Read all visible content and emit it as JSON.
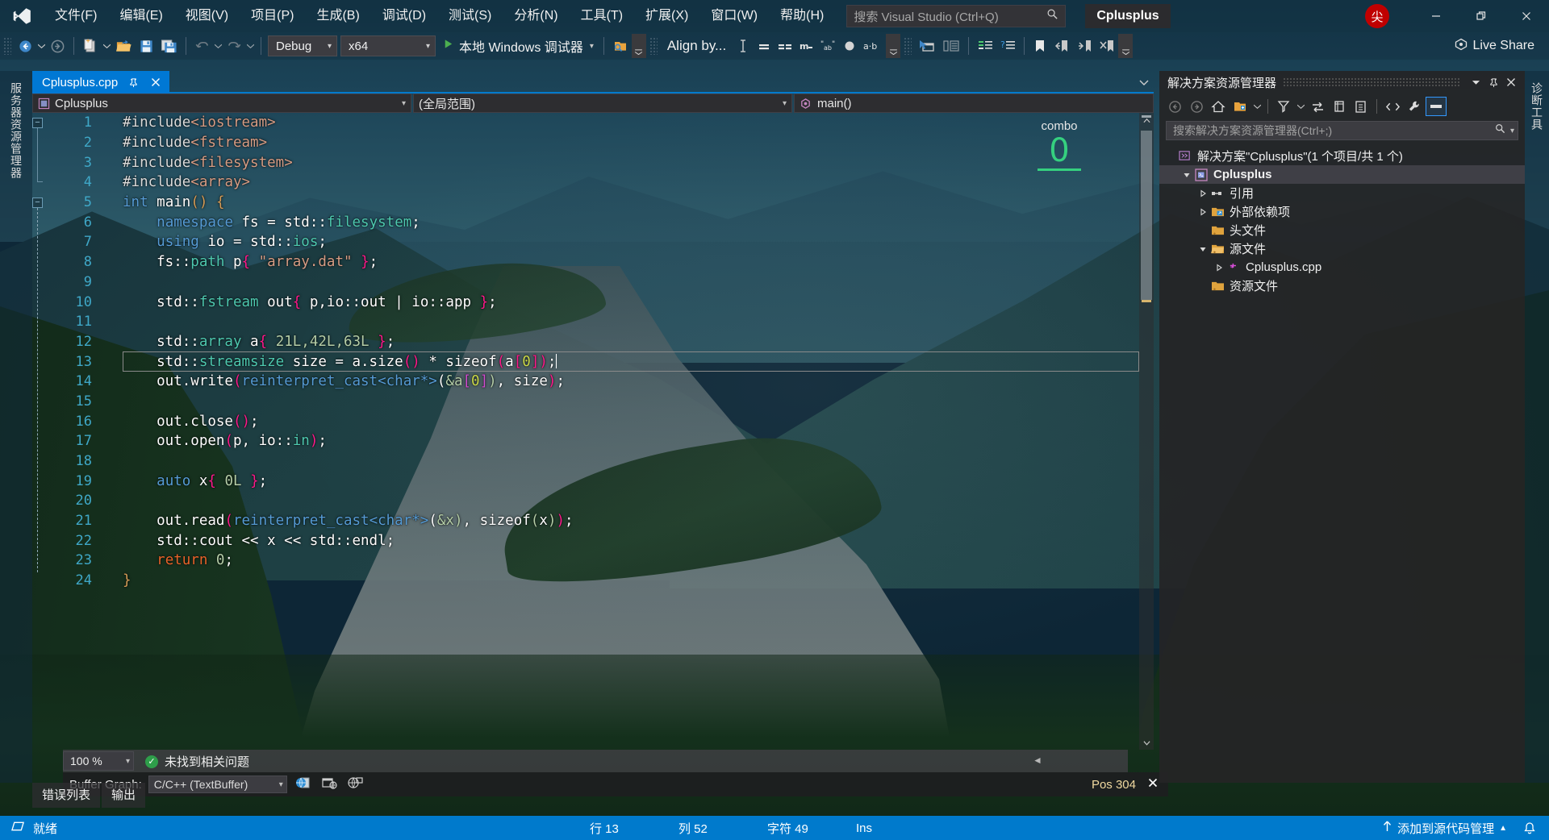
{
  "titlebar": {
    "logo_icon": "visual-studio-logo",
    "menus": [
      {
        "label": "文件(F)"
      },
      {
        "label": "编辑(E)"
      },
      {
        "label": "视图(V)"
      },
      {
        "label": "项目(P)"
      },
      {
        "label": "生成(B)"
      },
      {
        "label": "调试(D)"
      },
      {
        "label": "测试(S)"
      },
      {
        "label": "分析(N)"
      },
      {
        "label": "工具(T)"
      },
      {
        "label": "扩展(X)"
      },
      {
        "label": "窗口(W)"
      },
      {
        "label": "帮助(H)"
      }
    ],
    "search_placeholder": "搜索 Visual Studio (Ctrl+Q)",
    "search_icon": "search-icon",
    "project_chip": "Cplusplus",
    "avatar_text": "尖",
    "avatar_color": "#c00000",
    "minimize_icon": "minimize-icon",
    "restore_icon": "restore-icon",
    "close_icon": "close-icon"
  },
  "toolbar": {
    "nav_back_icon": "navigate-back-icon",
    "nav_forward_icon": "navigate-forward-icon",
    "new_item_icon": "new-item-icon",
    "open_file_icon": "open-file-icon",
    "save_icon": "save-icon",
    "save_all_icon": "save-all-icon",
    "undo_icon": "undo-icon",
    "redo_icon": "redo-icon",
    "config_value": "Debug",
    "platform_value": "x64",
    "run_label": "本地 Windows 调试器",
    "run_icon": "play-icon",
    "find_icon": "find-in-files-icon",
    "align_label": "Align by...",
    "align_icons": [
      "text-cursor-icon",
      "align-single-icon",
      "align-double-icon",
      "align-m-icon",
      "align-quote-icon",
      "align-circle-icon",
      "align-ab-icon"
    ],
    "ptr_icon": "pointer-window-icon",
    "split_icon": "split-window-icon",
    "indent_icon": "indent-lines-icon",
    "question_icon": "question-lines-icon",
    "bookmark_icon": "bookmark-icon",
    "bookmark_prev_icon": "bookmark-prev-icon",
    "bookmark_next_icon": "bookmark-next-icon",
    "bookmark_clear_icon": "bookmark-clear-icon",
    "overflow_icon": "toolbar-overflow-icon",
    "live_share_label": "Live Share",
    "live_share_icon": "live-share-icon"
  },
  "left_strip": {
    "label": "服务器资源管理器"
  },
  "right_strip": {
    "label": "诊断工具"
  },
  "editor": {
    "tab": {
      "name": "Cplusplus.cpp",
      "pin_icon": "pin-icon",
      "close_icon": "close-icon"
    },
    "nav": {
      "project": "Cplusplus",
      "project_icon": "cpp-project-icon",
      "scope": "(全局范围)",
      "member": "main()",
      "member_icon": "method-icon"
    },
    "combo_widget": {
      "label": "combo",
      "value": "0",
      "color": "#35d07f"
    },
    "lines": [
      {
        "n": "1",
        "tokens": [
          {
            "t": "#include",
            "c": "pp"
          },
          {
            "t": "<iostream>",
            "c": "inc"
          }
        ]
      },
      {
        "n": "2",
        "tokens": [
          {
            "t": "#include",
            "c": "pp"
          },
          {
            "t": "<fstream>",
            "c": "inc"
          }
        ]
      },
      {
        "n": "3",
        "tokens": [
          {
            "t": "#include",
            "c": "pp"
          },
          {
            "t": "<filesystem>",
            "c": "inc"
          }
        ]
      },
      {
        "n": "4",
        "tokens": [
          {
            "t": "#include",
            "c": "pp"
          },
          {
            "t": "<array>",
            "c": "inc"
          }
        ]
      },
      {
        "n": "5",
        "tokens": [
          {
            "t": "int",
            "c": "k"
          },
          {
            "t": " ",
            "c": "wht"
          },
          {
            "t": "main",
            "c": "wht"
          },
          {
            "t": "()",
            "c": "kor"
          },
          {
            "t": " ",
            "c": "wht"
          },
          {
            "t": "{",
            "c": "kor"
          }
        ]
      },
      {
        "n": "6",
        "tokens": [
          {
            "t": "    ",
            "c": "wht"
          },
          {
            "t": "namespace",
            "c": "k"
          },
          {
            "t": " fs ",
            "c": "wht"
          },
          {
            "t": "=",
            "c": "wht"
          },
          {
            "t": " std::",
            "c": "wht"
          },
          {
            "t": "filesystem",
            "c": "ty"
          },
          {
            "t": ";",
            "c": "wht"
          }
        ]
      },
      {
        "n": "7",
        "tokens": [
          {
            "t": "    ",
            "c": "wht"
          },
          {
            "t": "using",
            "c": "k"
          },
          {
            "t": " io ",
            "c": "wht"
          },
          {
            "t": "=",
            "c": "wht"
          },
          {
            "t": " std::",
            "c": "wht"
          },
          {
            "t": "ios",
            "c": "ty"
          },
          {
            "t": ";",
            "c": "wht"
          }
        ]
      },
      {
        "n": "8",
        "tokens": [
          {
            "t": "    fs::",
            "c": "wht"
          },
          {
            "t": "path",
            "c": "ty"
          },
          {
            "t": " p",
            "c": "wht"
          },
          {
            "t": "{",
            "c": "mag"
          },
          {
            "t": " ",
            "c": "wht"
          },
          {
            "t": "\"array.dat\"",
            "c": "str"
          },
          {
            "t": " ",
            "c": "wht"
          },
          {
            "t": "}",
            "c": "mag"
          },
          {
            "t": ";",
            "c": "wht"
          }
        ]
      },
      {
        "n": "9",
        "tokens": []
      },
      {
        "n": "10",
        "tokens": [
          {
            "t": "    std::",
            "c": "wht"
          },
          {
            "t": "fstream",
            "c": "ty"
          },
          {
            "t": " out",
            "c": "wht"
          },
          {
            "t": "{",
            "c": "mag"
          },
          {
            "t": " p,io::out ",
            "c": "wht"
          },
          {
            "t": "|",
            "c": "wht"
          },
          {
            "t": " io::app ",
            "c": "wht"
          },
          {
            "t": "}",
            "c": "mag"
          },
          {
            "t": ";",
            "c": "wht"
          }
        ]
      },
      {
        "n": "11",
        "tokens": []
      },
      {
        "n": "12",
        "tokens": [
          {
            "t": "    std::",
            "c": "wht"
          },
          {
            "t": "array",
            "c": "ty"
          },
          {
            "t": " a",
            "c": "wht"
          },
          {
            "t": "{",
            "c": "mag"
          },
          {
            "t": " ",
            "c": "wht"
          },
          {
            "t": "21L,42L,63L",
            "c": "num"
          },
          {
            "t": " ",
            "c": "wht"
          },
          {
            "t": "}",
            "c": "mag"
          },
          {
            "t": ";",
            "c": "wht"
          }
        ]
      },
      {
        "n": "13",
        "tokens": [
          {
            "t": "    std::",
            "c": "wht"
          },
          {
            "t": "streamsize",
            "c": "ty"
          },
          {
            "t": " size ",
            "c": "wht"
          },
          {
            "t": "=",
            "c": "wht"
          },
          {
            "t": " a.size",
            "c": "wht"
          },
          {
            "t": "()",
            "c": "mag"
          },
          {
            "t": " * sizeof",
            "c": "wht"
          },
          {
            "t": "(",
            "c": "mag"
          },
          {
            "t": "a",
            "c": "wht"
          },
          {
            "t": "[",
            "c": "mag"
          },
          {
            "t": "0",
            "c": "ylw"
          },
          {
            "t": "]",
            "c": "mag"
          },
          {
            "t": ")",
            "c": "mag"
          },
          {
            "t": ";",
            "c": "wht"
          }
        ],
        "current": true
      },
      {
        "n": "14",
        "tokens": [
          {
            "t": "    out.write",
            "c": "wht"
          },
          {
            "t": "(",
            "c": "mag"
          },
          {
            "t": "reinterpret_cast",
            "c": "k"
          },
          {
            "t": "<char*>",
            "c": "k"
          },
          {
            "t": "(",
            "c": "wht"
          },
          {
            "t": "&a",
            "c": "grn"
          },
          {
            "t": "[",
            "c": "vio"
          },
          {
            "t": "0",
            "c": "ylw"
          },
          {
            "t": "]",
            "c": "vio"
          },
          {
            "t": ")",
            "c": "grn"
          },
          {
            "t": ", size",
            "c": "wht"
          },
          {
            "t": ")",
            "c": "mag"
          },
          {
            "t": ";",
            "c": "wht"
          }
        ]
      },
      {
        "n": "15",
        "tokens": []
      },
      {
        "n": "16",
        "tokens": [
          {
            "t": "    out.close",
            "c": "wht"
          },
          {
            "t": "()",
            "c": "mag"
          },
          {
            "t": ";",
            "c": "wht"
          }
        ]
      },
      {
        "n": "17",
        "tokens": [
          {
            "t": "    out.open",
            "c": "wht"
          },
          {
            "t": "(",
            "c": "mag"
          },
          {
            "t": "p, io::",
            "c": "wht"
          },
          {
            "t": "in",
            "c": "ty"
          },
          {
            "t": ")",
            "c": "mag"
          },
          {
            "t": ";",
            "c": "wht"
          }
        ]
      },
      {
        "n": "18",
        "tokens": []
      },
      {
        "n": "19",
        "tokens": [
          {
            "t": "    ",
            "c": "wht"
          },
          {
            "t": "auto",
            "c": "k"
          },
          {
            "t": " x",
            "c": "wht"
          },
          {
            "t": "{",
            "c": "mag"
          },
          {
            "t": " ",
            "c": "wht"
          },
          {
            "t": "0L",
            "c": "num"
          },
          {
            "t": " ",
            "c": "wht"
          },
          {
            "t": "}",
            "c": "mag"
          },
          {
            "t": ";",
            "c": "wht"
          }
        ]
      },
      {
        "n": "20",
        "tokens": []
      },
      {
        "n": "21",
        "tokens": [
          {
            "t": "    out.read",
            "c": "wht"
          },
          {
            "t": "(",
            "c": "mag"
          },
          {
            "t": "reinterpret_cast",
            "c": "k"
          },
          {
            "t": "<char*>",
            "c": "k"
          },
          {
            "t": "(",
            "c": "wht"
          },
          {
            "t": "&x",
            "c": "grn"
          },
          {
            "t": ")",
            "c": "grn"
          },
          {
            "t": ", sizeof",
            "c": "wht"
          },
          {
            "t": "(",
            "c": "grn"
          },
          {
            "t": "x",
            "c": "wht"
          },
          {
            "t": ")",
            "c": "grn"
          },
          {
            "t": ")",
            "c": "mag"
          },
          {
            "t": ";",
            "c": "wht"
          }
        ]
      },
      {
        "n": "22",
        "tokens": [
          {
            "t": "    std::cout << x << std::endl;",
            "c": "wht"
          }
        ]
      },
      {
        "n": "23",
        "tokens": [
          {
            "t": "    ",
            "c": "wht"
          },
          {
            "t": "return",
            "c": "ret"
          },
          {
            "t": " ",
            "c": "wht"
          },
          {
            "t": "0",
            "c": "num"
          },
          {
            "t": ";",
            "c": "wht"
          }
        ]
      },
      {
        "n": "24",
        "tokens": [
          {
            "t": "}",
            "c": "kor"
          }
        ]
      }
    ],
    "footer": {
      "zoom": "100 %",
      "issues_text": "未找到相关问题",
      "issues_icon": "check-circle-icon",
      "buffer_graph_label": "Buffer Graph:",
      "buffer_graph_value": "C/C++ (TextBuffer)",
      "buffer_icons": [
        "globe-doc-icon",
        "window-graph-icon",
        "globe-window-icon"
      ],
      "pos_text": "Pos 304",
      "pos_close_icon": "close-icon"
    },
    "bottom_tabs": [
      {
        "label": "错误列表"
      },
      {
        "label": "输出"
      }
    ]
  },
  "solution_explorer": {
    "title": "解决方案资源管理器",
    "header_icons": [
      "chevron-down-icon",
      "pin-icon",
      "close-icon"
    ],
    "toolbar_icons": [
      "navigate-back-icon",
      "navigate-forward-icon",
      "home-icon",
      "sync-with-file-icon",
      "pending-changes-icon",
      "refresh-icon",
      "show-all-files-icon",
      "collapse-all-icon",
      "code-view-icon",
      "properties-icon",
      "preview-pane-icon"
    ],
    "search_placeholder": "搜索解决方案资源管理器(Ctrl+;)",
    "search_icon": "search-icon",
    "tree": [
      {
        "label": "解决方案\"Cplusplus\"(1 个项目/共 1 个)",
        "indent": 0,
        "expander": "",
        "icon": "solution-icon",
        "bold": false,
        "selected": false
      },
      {
        "label": "Cplusplus",
        "indent": 1,
        "expander": "expanded",
        "icon": "cpp-project-icon",
        "bold": true,
        "selected": true
      },
      {
        "label": "引用",
        "indent": 2,
        "expander": "collapsed",
        "icon": "references-icon",
        "bold": false,
        "selected": false
      },
      {
        "label": "外部依赖项",
        "indent": 2,
        "expander": "collapsed",
        "icon": "ext-deps-icon",
        "bold": false,
        "selected": false
      },
      {
        "label": "头文件",
        "indent": 2,
        "expander": "",
        "icon": "folder-icon",
        "bold": false,
        "selected": false
      },
      {
        "label": "源文件",
        "indent": 2,
        "expander": "expanded",
        "icon": "folder-open-icon",
        "bold": false,
        "selected": false
      },
      {
        "label": "Cplusplus.cpp",
        "indent": 3,
        "expander": "collapsed",
        "icon": "cpp-file-icon",
        "bold": false,
        "selected": false
      },
      {
        "label": "资源文件",
        "indent": 2,
        "expander": "",
        "icon": "folder-icon",
        "bold": false,
        "selected": false
      }
    ]
  },
  "statusbar": {
    "ready_text": "就绪",
    "ready_icon": "ready-icon",
    "line_label": "行 13",
    "col_label": "列 52",
    "char_label": "字符 49",
    "insert_mode": "Ins",
    "scm_text": "添加到源代码管理",
    "scm_icon": "upload-arrow-icon",
    "scm_caret_icon": "chevron-up-icon",
    "bell_icon": "notification-bell-icon",
    "accent_color": "#007acc"
  }
}
